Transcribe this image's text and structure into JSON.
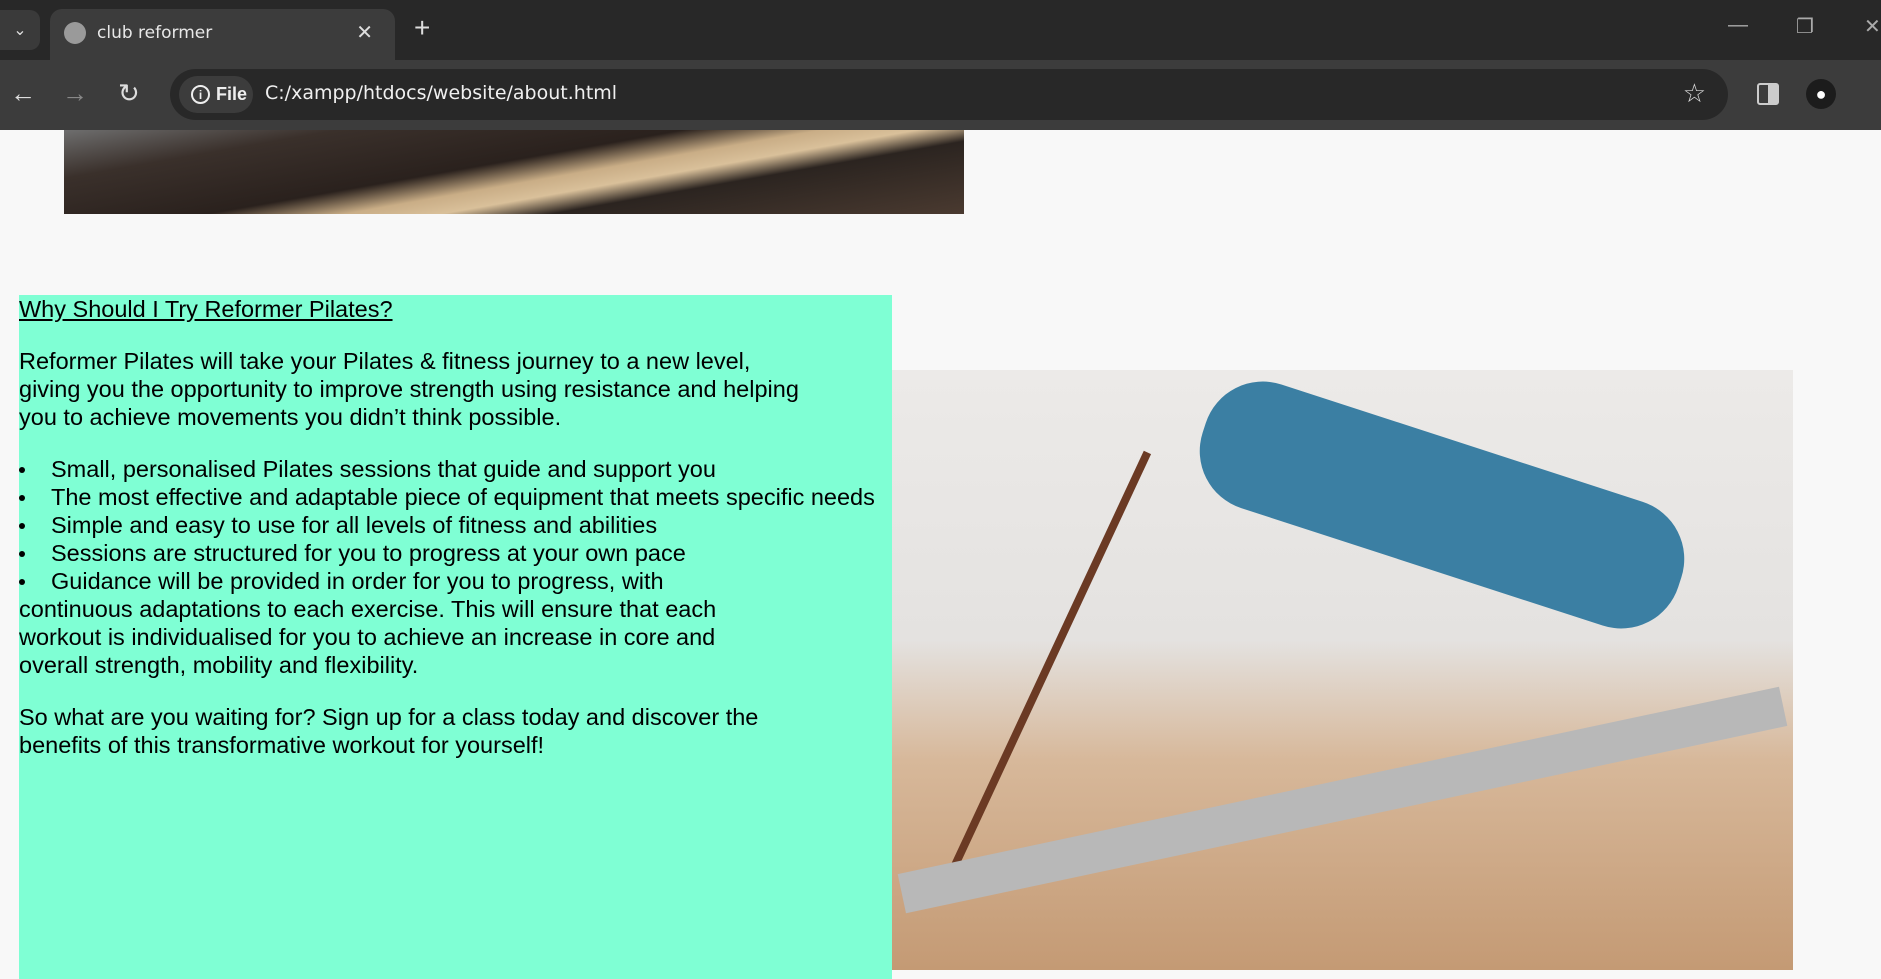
{
  "browser": {
    "tab_title": "club reformer",
    "address_chip": "File",
    "url": "C:/xampp/htdocs/website/about.html"
  },
  "content": {
    "heading": "Why Should I Try Reformer Pilates?",
    "intro": "Reformer Pilates will take your Pilates & fitness journey to a new level, giving you the opportunity to improve strength using resistance and helping you to achieve movements you didn’t think possible.",
    "bullets": [
      "Small, personalised Pilates sessions that guide and support you",
      "The most effective and adaptable piece of equipment that meets specific needs",
      "Simple and easy to use for all levels of fitness and abilities",
      "Sessions are structured for you to progress at your own pace",
      "Guidance will be provided in order for you to progress, with"
    ],
    "continuation": "continuous adaptations to each exercise. This will ensure that each workout is individualised for you to achieve an increase in core and overall strength, mobility and flexibility.",
    "closing": "So what are you waiting for? Sign up for a class today and discover the benefits of this transformative workout for yourself!",
    "background_color": "#7fffd4"
  }
}
